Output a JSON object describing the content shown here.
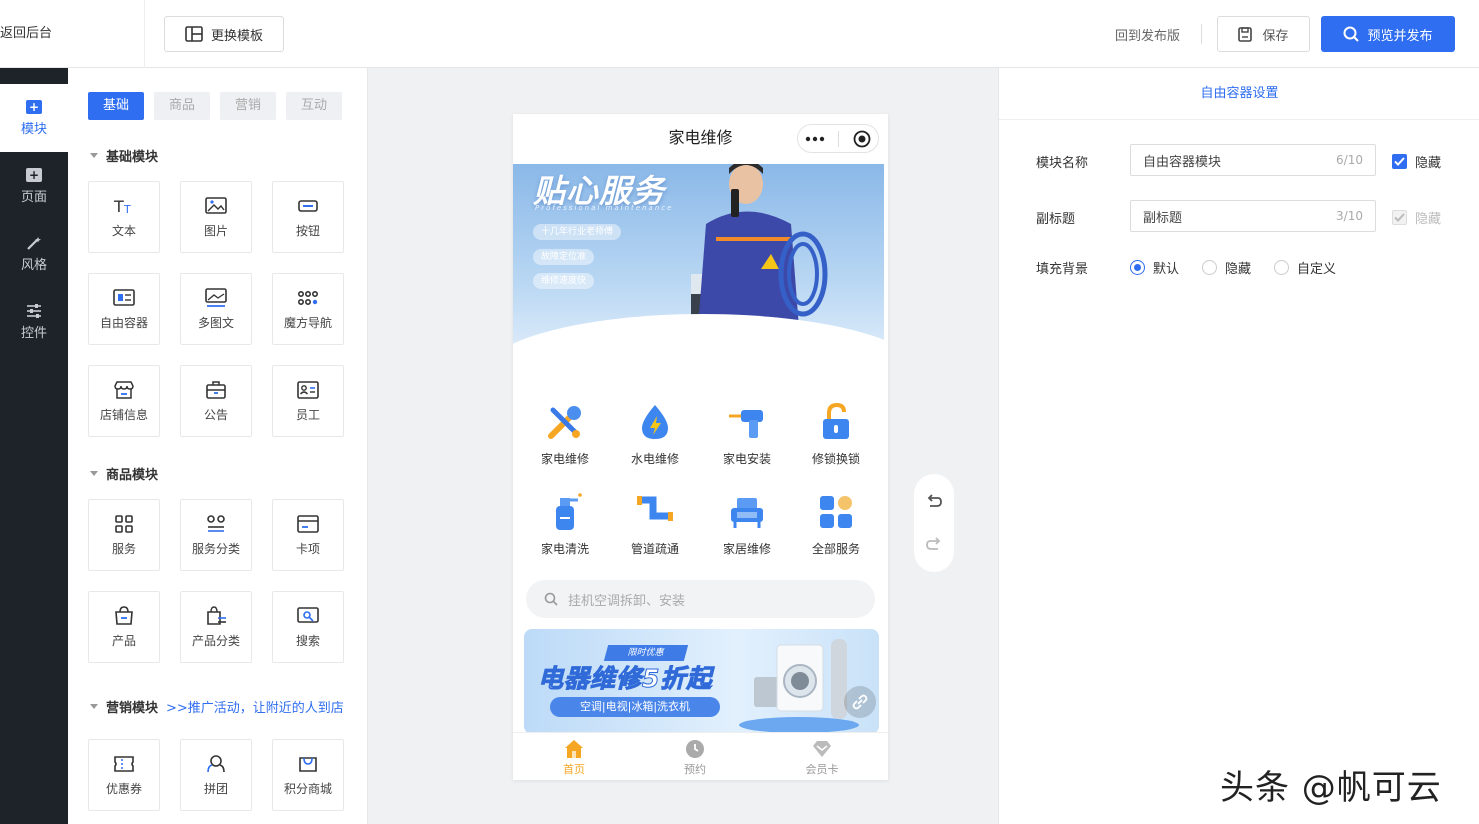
{
  "topbar": {
    "back_label": "返回后台",
    "template_button": "更换模板",
    "restore_label": "回到发布版",
    "save_label": "保存",
    "publish_label": "预览并发布"
  },
  "leftnav": {
    "items": [
      {
        "label": "模块",
        "active": true
      },
      {
        "label": "页面"
      },
      {
        "label": "风格"
      },
      {
        "label": "控件"
      }
    ]
  },
  "components": {
    "tabs": [
      "基础",
      "商品",
      "营销",
      "互动"
    ],
    "sections": [
      {
        "title": "基础模块",
        "items": [
          "文本",
          "图片",
          "按钮",
          "自由容器",
          "多图文",
          "魔方导航",
          "店铺信息",
          "公告",
          "员工"
        ]
      },
      {
        "title": "商品模块",
        "items": [
          "服务",
          "服务分类",
          "卡项",
          "产品",
          "产品分类",
          "搜索"
        ]
      },
      {
        "title": "营销模块",
        "promo": ">>推广活动，让附近的人到店",
        "items": [
          "优惠券",
          "拼团",
          "积分商城"
        ]
      }
    ]
  },
  "phone": {
    "title": "家电维修",
    "banner": {
      "title": "贴心服务",
      "subtitle": "Professional maintenance",
      "pills": [
        "十几年行业老师傅",
        "故障定位准",
        "维修速度快"
      ]
    },
    "grid": [
      "家电维修",
      "水电维修",
      "家电安装",
      "修锁换锁",
      "家电清洗",
      "管道疏通",
      "家居维修",
      "全部服务"
    ],
    "search_placeholder": "挂机空调拆卸、安装",
    "promo": {
      "tag": "限时优惠",
      "title": "电器维修5折起",
      "subtitle": "空调|电视|冰箱|洗衣机"
    },
    "tabbar": [
      "首页",
      "预约",
      "会员卡"
    ]
  },
  "settings": {
    "title": "自由容器设置",
    "module_name_label": "模块名称",
    "module_name_value": "自由容器模块",
    "module_name_count": "6/10",
    "hide_label_1": "隐藏",
    "subtitle_label": "副标题",
    "subtitle_value": "副标题",
    "subtitle_count": "3/10",
    "hide_label_2": "隐藏",
    "fill_label": "填充背景",
    "fill_options": [
      "默认",
      "隐藏",
      "自定义"
    ],
    "fill_selected": "默认"
  },
  "watermark": "头条 @帆可云",
  "colors": {
    "accent": "#2f6ef0",
    "sidebar": "#1e2329",
    "tab_active": "#f5a623"
  }
}
